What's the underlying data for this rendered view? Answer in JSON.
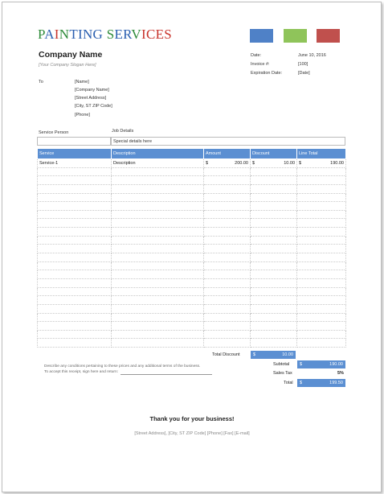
{
  "header": {
    "title_parts": [
      {
        "text": "P",
        "color": "#2e8b3a"
      },
      {
        "text": "A",
        "color": "#2a5fb0"
      },
      {
        "text": "I",
        "color": "#c8332b"
      },
      {
        "text": "N",
        "color": "#2e8b3a"
      },
      {
        "text": "TING ",
        "color": "#2a5fb0"
      },
      {
        "text": "S",
        "color": "#2e8b3a"
      },
      {
        "text": "ER",
        "color": "#2a5fb0"
      },
      {
        "text": "V",
        "color": "#2e8b3a"
      },
      {
        "text": "I",
        "color": "#c8332b"
      },
      {
        "text": "CES",
        "color": "#c8332b"
      }
    ],
    "swatches": [
      "#4f81c7",
      "#8fc45a",
      "#c0504d"
    ],
    "company_name": "Company Name",
    "slogan": "[Your Company Slogan Here]"
  },
  "meta": {
    "date_label": "Date:",
    "date_value": "June 10, 2016",
    "invoice_label": "Invoice #:",
    "invoice_value": "[100]",
    "expiration_label": "Expiration Date:",
    "expiration_value": "[Date]"
  },
  "to": {
    "label": "To",
    "lines": [
      "[Name]",
      "[Company Name]",
      "[Street Address]",
      "[City, ST  ZIP Code]",
      "[Phone]"
    ]
  },
  "service_info": {
    "person_label": "Service Person",
    "job_label": "Job Details",
    "job_value": "Special details here"
  },
  "table": {
    "headers": [
      "Service",
      "Description",
      "Amount",
      "Discount",
      "Line Total"
    ],
    "currency": "$",
    "rows": [
      {
        "service": "Service-1",
        "description": "Description",
        "amount": "200.00",
        "discount": "10.00",
        "total": "190.00"
      }
    ],
    "empty_rows": 21
  },
  "totals": {
    "total_discount_label": "Total Discount",
    "total_discount_value": "10.00",
    "subtotal_label": "Subtotal",
    "subtotal_value": "190.00",
    "sales_tax_label": "Sales Tax",
    "sales_tax_value": "5%",
    "total_label": "Total",
    "total_value": "199.50",
    "currency": "$"
  },
  "notes": {
    "line1": "Describe any conditions pertaining to these prices and any additional terms of the business.",
    "line2": "To accept this receipt, sign here and return:"
  },
  "footer": {
    "thanks": "Thank you for your business!",
    "address": "[Street Address],  [City, ST  ZIP Code]   [Phone]   [Fax]   [E-mail]"
  }
}
